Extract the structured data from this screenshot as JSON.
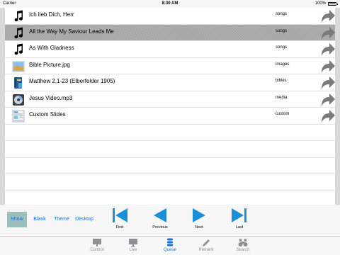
{
  "status_bar": {
    "carrier": "Carrier",
    "time": "8:30 AM",
    "battery": "100%"
  },
  "queue": {
    "items": [
      {
        "title": "Ich lieb Dich, Herr",
        "type": "songs",
        "icon": "music-note-icon",
        "selected": false
      },
      {
        "title": "All the Way My Saviour Leads Me",
        "type": "songs",
        "icon": "music-note-icon",
        "selected": true
      },
      {
        "title": "As With Gladness",
        "type": "songs",
        "icon": "music-note-icon",
        "selected": false
      },
      {
        "title": "Bible Picture.jpg",
        "type": "images",
        "icon": "image-icon",
        "selected": false
      },
      {
        "title": "Matthew 2,1-23 (Elberfelder 1905)",
        "type": "bibles",
        "icon": "bible-icon",
        "selected": false
      },
      {
        "title": "Jesus Video.mp3",
        "type": "media",
        "icon": "media-icon",
        "selected": false
      },
      {
        "title": "Custom Slides",
        "type": "custom",
        "icon": "custom-slide-icon",
        "selected": false
      }
    ]
  },
  "controls": {
    "modes": {
      "show": "Show",
      "blank": "Blank",
      "theme": "Theme",
      "desktop": "Desktop"
    },
    "active_mode": "show",
    "nav": {
      "first": "First",
      "previous": "Previous",
      "next": "Next",
      "last": "Last"
    },
    "nav_color": "#1a8fd6"
  },
  "tabbar": {
    "tabs": {
      "control": "Control",
      "live": "Live",
      "queue": "Queue",
      "remark": "Remark",
      "search": "Search"
    },
    "active_tab": "queue",
    "active_color": "#1a6fd6",
    "inactive_color": "#8e8e93"
  }
}
